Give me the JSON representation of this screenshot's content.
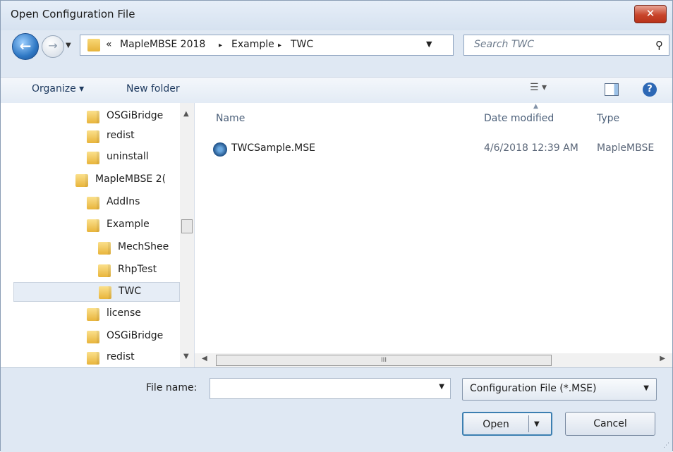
{
  "window": {
    "title": "Open Configuration File",
    "close_glyph": "✕"
  },
  "address": {
    "overflow": "«",
    "crumbs": [
      "MapleMBSE 2018",
      "Example",
      "TWC"
    ],
    "separator": "▸",
    "refresh_glyph": "⟳"
  },
  "search": {
    "placeholder": "Search TWC"
  },
  "toolbar": {
    "organize": "Organize ▾",
    "new_folder": "New folder",
    "view_glyph": "☰ ▾",
    "help_glyph": "?"
  },
  "navigation": {
    "items": [
      {
        "label": "OSGiBridge",
        "level": 2
      },
      {
        "label": "redist",
        "level": 2
      },
      {
        "label": "uninstall",
        "level": 2
      },
      {
        "label": "MapleMBSE 2(",
        "level": 1
      },
      {
        "label": "AddIns",
        "level": 2
      },
      {
        "label": "Example",
        "level": 2
      },
      {
        "label": "MechShee",
        "level": 3
      },
      {
        "label": "RhpTest",
        "level": 3
      },
      {
        "label": "TWC",
        "level": 3,
        "selected": true
      },
      {
        "label": "license",
        "level": 2
      },
      {
        "label": "OSGiBridge",
        "level": 2
      },
      {
        "label": "redist",
        "level": 2
      }
    ]
  },
  "file_list": {
    "columns": [
      "Name",
      "Date modified",
      "Type"
    ],
    "rows": [
      {
        "name": "TWCSample.MSE",
        "date": "4/6/2018 12:39 AM",
        "type": "MapleMBSE"
      }
    ],
    "scroll_thumb_glyph": "III"
  },
  "footer": {
    "file_name_label": "File name:",
    "file_name_value": "",
    "filter": "Configuration File (*.MSE)",
    "open_label": "Open",
    "cancel_label": "Cancel"
  },
  "colors": {
    "accent": "#3c7fb1",
    "window_bg": "#dfe8f3",
    "close": "#c8452b"
  }
}
